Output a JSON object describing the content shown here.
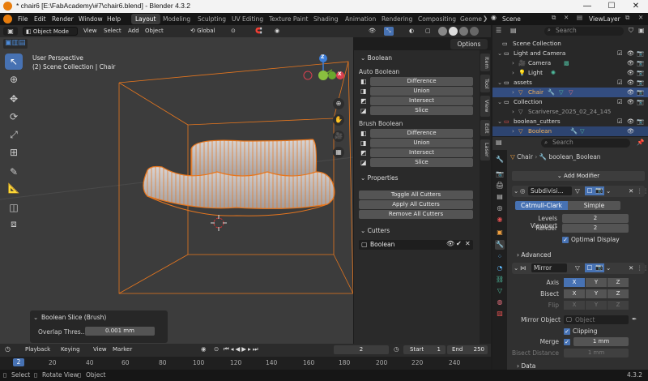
{
  "window": {
    "title": "* chair6 [E:\\FabAcademy\\#7\\chair6.blend] - Blender 4.3.2",
    "minimize": "—",
    "maximize": "☐",
    "close": "✕"
  },
  "menubar": {
    "items": [
      "File",
      "Edit",
      "Render",
      "Window",
      "Help"
    ],
    "workspaces": [
      "Layout",
      "Modeling",
      "Sculpting",
      "UV Editing",
      "Texture Paint",
      "Shading",
      "Animation",
      "Rendering",
      "Compositing",
      "Geome"
    ],
    "scene": "Scene",
    "view_layer": "ViewLayer"
  },
  "viewport_header": {
    "mode": "Object Mode",
    "menus": [
      "View",
      "Select",
      "Add",
      "Object"
    ],
    "orientation": "Global",
    "options": "Options"
  },
  "viewport": {
    "perspective": "User Perspective",
    "context": "(2) Scene Collection | Chair",
    "gizmo_z": "Z",
    "gizmo_x": "X"
  },
  "n_panel": {
    "title": "Boolean",
    "auto_boolean": "Auto Boolean",
    "auto_ops": [
      "Difference",
      "Union",
      "Intersect",
      "Slice"
    ],
    "brush_boolean": "Brush Boolean",
    "brush_ops": [
      "Difference",
      "Union",
      "Intersect",
      "Slice"
    ],
    "properties": "Properties",
    "prop_btns": [
      "Toggle All Cutters",
      "Apply All Cutters",
      "Remove All Cutters"
    ],
    "cutters": "Cutters",
    "cutter_name": "Boolean"
  },
  "side_tabs": [
    "Item",
    "Tool",
    "View",
    "Edit",
    "Laser"
  ],
  "last_op": {
    "title": "Boolean Slice (Brush)",
    "label": "Overlap Thres...",
    "value": "0.001 mm"
  },
  "outliner": {
    "search": "Search",
    "rows": [
      {
        "label": "Scene Collection"
      },
      {
        "label": "Light and Camera"
      },
      {
        "label": "Camera"
      },
      {
        "label": "Light"
      },
      {
        "label": "assets"
      },
      {
        "label": "Chair"
      },
      {
        "label": "Collection"
      },
      {
        "label": "Scariverse_2025_02_24_145"
      },
      {
        "label": "boolean_cutters"
      },
      {
        "label": "Boolean"
      }
    ]
  },
  "properties": {
    "search": "Search",
    "breadcrumb_obj": "Chair",
    "breadcrumb_mod": "boolean_Boolean",
    "add_modifier": "Add Modifier",
    "subdiv_name": "Subdivisi...",
    "catmull": "Catmull-Clark",
    "simple": "Simple",
    "levels_label": "Levels Viewport",
    "levels_val": "2",
    "render_label": "Render",
    "render_val": "2",
    "optimal": "Optimal Display",
    "advanced": "Advanced",
    "mirror_name": "Mirror",
    "axis_label": "Axis",
    "bisect_label": "Bisect",
    "flip_label": "Flip",
    "axes": [
      "X",
      "Y",
      "Z"
    ],
    "mirror_object_label": "Mirror Object",
    "mirror_object_ph": "Object",
    "clipping": "Clipping",
    "merge_label": "Merge",
    "merge_val": "1 mm",
    "bisect_dist_label": "Bisect Distance",
    "bisect_dist_val": "1 mm",
    "data": "Data"
  },
  "timeline": {
    "menus": [
      "Playback",
      "Keying",
      "View",
      "Marker"
    ],
    "frame": "2",
    "start_label": "Start",
    "start": "1",
    "end_label": "End",
    "end": "250",
    "ruler": [
      "2",
      "20",
      "40",
      "60",
      "80",
      "100",
      "120",
      "140",
      "160",
      "180",
      "200",
      "220",
      "240"
    ]
  },
  "statusbar": {
    "select": "Select",
    "rotate": "Rotate View",
    "object": "Object",
    "version": "4.3.2"
  },
  "colors": {
    "accent": "#4772b3",
    "selection_orange": "#f08a24",
    "bg": "#3c3c3c"
  }
}
